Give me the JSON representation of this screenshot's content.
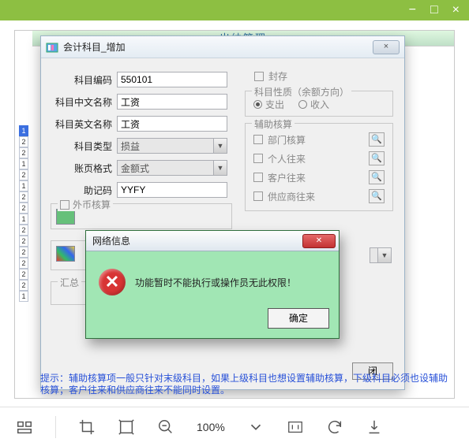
{
  "app_titlebar": {
    "min": "−",
    "max": "□",
    "close": "×"
  },
  "banner": "出纳管理",
  "rail": [
    "1",
    "2",
    "2",
    "1",
    "2",
    "1",
    "2",
    "2",
    "1",
    "2",
    "2",
    "2",
    "2",
    "2",
    "2",
    "1"
  ],
  "win": {
    "title": "会计科目_增加",
    "close": "×",
    "rows": {
      "code_label": "科目编码",
      "code_val": "550101",
      "cn_label": "科目中文名称",
      "cn_val": "工资",
      "en_label": "科目英文名称",
      "en_val": "工资",
      "type_label": "科目类型",
      "type_val": "损益",
      "page_label": "账页格式",
      "page_val": "金额式",
      "mnemo_label": "助记码",
      "mnemo_val": "YYFY"
    },
    "right": {
      "seal": "封存",
      "nature_title": "科目性质（余额方向）",
      "nature_out": "支出",
      "nature_in": "收入",
      "aux_title": "辅助核算",
      "aux_items": [
        "部门核算",
        "个人往来",
        "客户往来",
        "供应商往来"
      ]
    },
    "ll": {
      "fc_title": "外币核算",
      "hz_title": "汇总",
      "fc_blank": ""
    },
    "close_btn": "闭"
  },
  "modal": {
    "title": "网络信息",
    "close": "✕",
    "msg": "功能暂时不能执行或操作员无此权限！",
    "ok": "确定"
  },
  "hint": "提示：辅助核算项一般只针对末级科目，如果上级科目也想设置辅助核算，下级科目必须也设辅助核算；客户往来和供应商往来不能同时设置。",
  "toolbar": {
    "zoom": "100%"
  }
}
